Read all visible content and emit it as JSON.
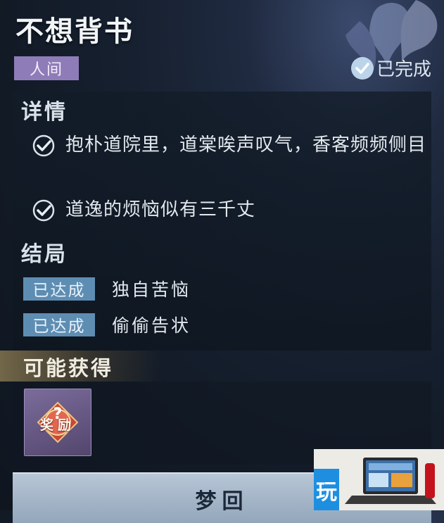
{
  "header": {
    "title": "不想背书",
    "realm_tag": "人间",
    "status_text": "已完成"
  },
  "details": {
    "heading": "详情",
    "items": [
      {
        "text": "抱朴道院里，道棠唉声叹气，香客频频侧目",
        "done": true
      },
      {
        "text": "道逸的烦恼似有三千丈",
        "done": true
      }
    ]
  },
  "endings": {
    "heading": "结局",
    "items": [
      {
        "tag": "已达成",
        "text": "独自苦恼"
      },
      {
        "tag": "已达成",
        "text": "偷偷告状"
      }
    ]
  },
  "rewards": {
    "heading": "可能获得",
    "item_label": "奖励"
  },
  "action": {
    "button_label": "梦回"
  },
  "watermark": {
    "badge_text": "玩"
  },
  "colors": {
    "realm_tag": "#8e7cb8",
    "ending_tag": "#5e8db3",
    "button": "#a8b8ca",
    "reward_header": "#c4a868"
  }
}
